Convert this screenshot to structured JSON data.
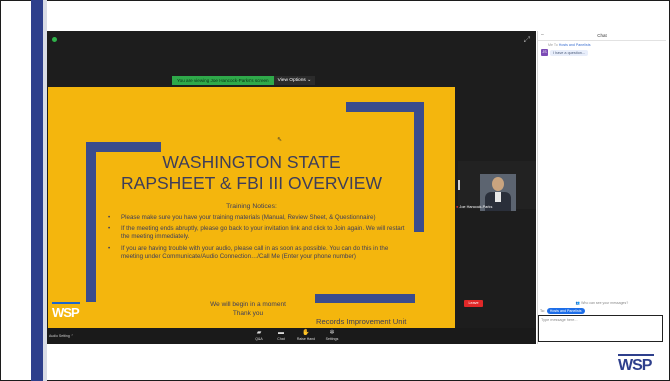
{
  "viewing_banner": {
    "message": "You are viewing Joe Hancock-Parks's screen",
    "view_options": "View Options ⌄"
  },
  "slide": {
    "title_line1": "WASHINGTON STATE",
    "title_line2": "RAPSHEET & FBI III OVERVIEW",
    "notices_heading": "Training Notices:",
    "bullets": [
      "Please make sure you have your training materials (Manual, Review Sheet, & Questionnaire)",
      "If the meeting ends abruptly, please go back to your invitation link and click to Join again. We will restart the meeting immediately.",
      "If you are having trouble with your audio, please call in as soon as possible. You can do this in the meeting under Communicate/Audio Connection…/Call Me (Enter your phone number)"
    ],
    "begin_line1": "We will begin in a moment",
    "begin_line2": "Thank you",
    "unit": "Records Improvement Unit",
    "logo": "WSP"
  },
  "participant": {
    "name": "Joe Hancock-Parks"
  },
  "toolbar": {
    "audio_setting": "Audio Setting ⌃",
    "buttons": [
      {
        "label": "Q&A",
        "icon": "qa-icon"
      },
      {
        "label": "Chat",
        "icon": "chat-icon"
      },
      {
        "label": "Raise Hand",
        "icon": "raise-hand-icon"
      },
      {
        "label": "Settings",
        "icon": "gear-icon"
      }
    ],
    "leave": "Leave"
  },
  "chat": {
    "title": "Chat",
    "me_to": "Me To",
    "recipient": "Hosts and Panelists",
    "avatar_initials": "JS",
    "message": "I have a question...",
    "who_can_see": "Who can see your messages?",
    "to_label": "To:",
    "to_value": "Hosts and Panelists",
    "input_placeholder": "Type message here..."
  },
  "corner_logo": "WSP",
  "colors": {
    "wsp_blue": "#2e3f8c",
    "slide_gold": "#f4b60d",
    "leave_red": "#e02828",
    "chat_blue": "#1e6ee8"
  }
}
